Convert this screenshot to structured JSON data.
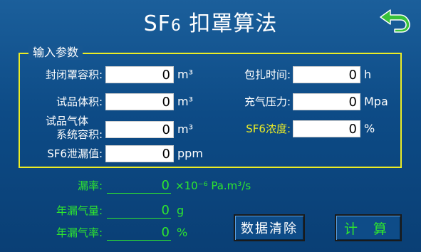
{
  "header": {
    "title_main": "SF",
    "title_sub": "6",
    "title_rest": " 扣罩算法"
  },
  "input_group": {
    "legend": "输入参数",
    "fields": [
      {
        "label": "封闭罩容积:",
        "value": "0",
        "unit": "m³"
      },
      {
        "label": "试品体积:",
        "value": "0",
        "unit": "m³"
      },
      {
        "label_line1": "试品气体",
        "label_line2": "系统容积:",
        "value": "0",
        "unit": "m³"
      },
      {
        "label": "SF6泄漏值:",
        "value": "0",
        "unit": "ppm"
      },
      {
        "label": "包扎时间:",
        "value": "0",
        "unit": "h"
      },
      {
        "label": "充气压力:",
        "value": "0",
        "unit": "Mpa"
      },
      {
        "label": "SF6浓度:",
        "value": "0",
        "unit": "%"
      }
    ]
  },
  "outputs": [
    {
      "label": "漏率:",
      "value": "0",
      "unit": "×10⁻⁶  Pa.m³/s"
    },
    {
      "label": "年漏气量:",
      "value": "0",
      "unit": "g"
    },
    {
      "label": "年漏气率:",
      "value": "0",
      "unit": "%"
    }
  ],
  "buttons": {
    "clear": "数据清除",
    "calc": "计 算"
  },
  "colors": {
    "background": "#0d4b86",
    "frame": "#ecec25",
    "output_text": "#2ee62e",
    "back_arrow": "#39c23a"
  },
  "icons": {
    "back": "return-arrow-icon"
  }
}
